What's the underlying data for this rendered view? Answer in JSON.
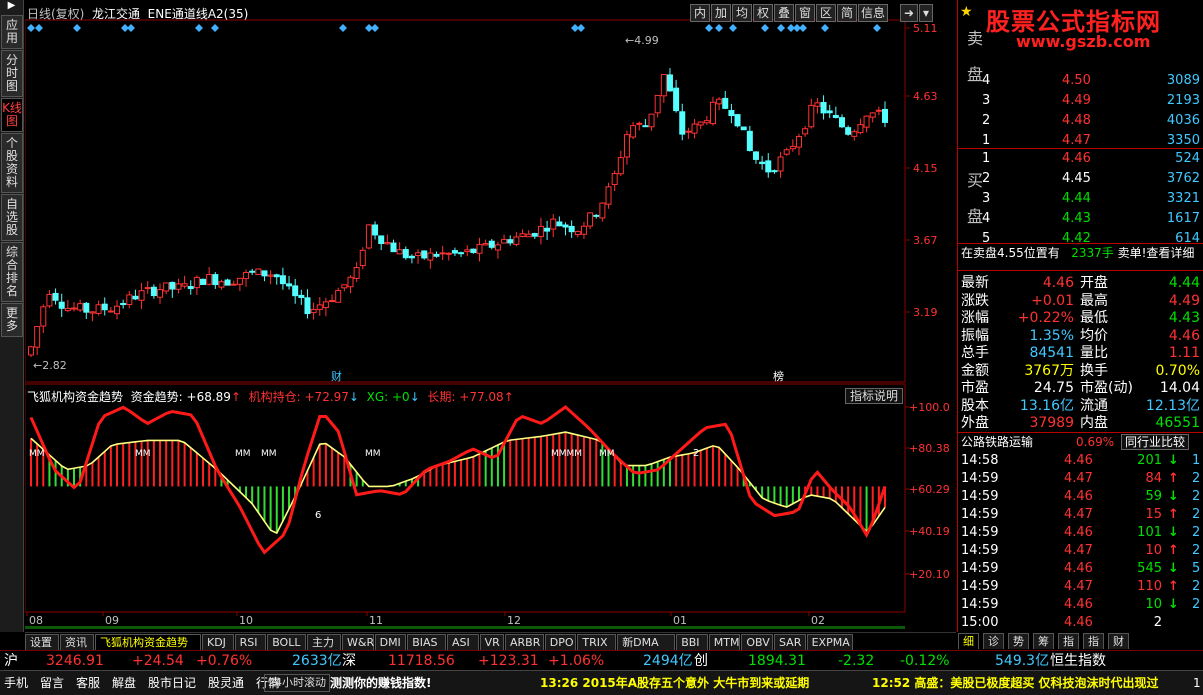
{
  "sidebar": [
    "应用",
    "分时图",
    "K线图",
    "个股资料",
    "自选股",
    "综合排名",
    "更多"
  ],
  "title": {
    "mode": "日线(复权)",
    "stock": "龙江交通",
    "indicator": "ENE通道线A2(35)"
  },
  "toolbar": [
    "内",
    "加",
    "均",
    "权",
    "叠",
    "窗",
    "区",
    "简",
    "信息"
  ],
  "price_axis": [
    "5.11",
    "4.63",
    "4.15",
    "3.67",
    "3.19"
  ],
  "price_marks": {
    "high": "4.99",
    "low": "2.82"
  },
  "markers": {
    "cai": "财",
    "bang": "榜"
  },
  "ind_header": {
    "name": "飞狐机构资金趋势",
    "t1": "资金趋势: +68.89",
    "t2": "机构持仓: +72.97",
    "t3": "XG: +0",
    "t4": "长期: +77.08",
    "btn": "指标说明"
  },
  "ind_axis": [
    "+100.0",
    "+80.38",
    "+60.29",
    "+40.19",
    "+20.10"
  ],
  "ind_labels": {
    "mm": "MM",
    "mmmm": "MMMM",
    "six": "6",
    "two": "2"
  },
  "months": [
    "08",
    "09",
    "10",
    "11",
    "12",
    "01",
    "02"
  ],
  "tabs": [
    "设置",
    "资讯",
    "飞狐机构资金趋势",
    "KDJ",
    "RSI",
    "BOLL",
    "主力",
    "W&R",
    "DMI",
    "BIAS",
    "ASI",
    "VR",
    "ARBR",
    "DPO",
    "TRIX",
    "新DMA",
    "BBI",
    "MTM",
    "OBV",
    "SAR",
    "EXPMA"
  ],
  "right": {
    "logo": "股票公式指标网",
    "url": "www.gszb.com",
    "sell_label": "卖盘",
    "buy_label": "买盘",
    "sell": [
      [
        "4",
        "4.50",
        "3089"
      ],
      [
        "3",
        "4.49",
        "2193"
      ],
      [
        "2",
        "4.48",
        "4036"
      ],
      [
        "1",
        "4.47",
        "3350"
      ]
    ],
    "buy": [
      [
        "1",
        "4.46",
        "524"
      ],
      [
        "2",
        "4.45",
        "3762"
      ],
      [
        "3",
        "4.44",
        "3321"
      ],
      [
        "4",
        "4.43",
        "1617"
      ],
      [
        "5",
        "4.42",
        "614"
      ]
    ],
    "notice": "在卖盘4.55位置有",
    "notice_vol": "2337手",
    "notice_tail": "卖单!查看详细",
    "stats": [
      [
        "最新",
        "4.46",
        "开盘",
        "4.44"
      ],
      [
        "涨跌",
        "+0.01",
        "最高",
        "4.49"
      ],
      [
        "涨幅",
        "+0.22%",
        "最低",
        "4.43"
      ],
      [
        "振幅",
        "1.35%",
        "均价",
        "4.46"
      ],
      [
        "总手",
        "84541",
        "量比",
        "1.11"
      ],
      [
        "金额",
        "3767万",
        "换手",
        "0.70%"
      ],
      [
        "市盈",
        "24.75",
        "市盈(动)",
        "14.04"
      ],
      [
        "股本",
        "13.16亿",
        "流通",
        "12.13亿"
      ],
      [
        "外盘",
        "37989",
        "内盘",
        "46551"
      ]
    ],
    "sector": "公路铁路运输",
    "sector_pct": "0.69%",
    "sector_btn": "同行业比较",
    "ticks": [
      [
        "14:58",
        "4.46",
        "201",
        "↓",
        "1"
      ],
      [
        "14:59",
        "4.47",
        "84",
        "↑",
        "2"
      ],
      [
        "14:59",
        "4.46",
        "59",
        "↓",
        "2"
      ],
      [
        "14:59",
        "4.47",
        "15",
        "↑",
        "2"
      ],
      [
        "14:59",
        "4.46",
        "101",
        "↓",
        "2"
      ],
      [
        "14:59",
        "4.47",
        "10",
        "↑",
        "2"
      ],
      [
        "14:59",
        "4.46",
        "545",
        "↓",
        "5"
      ],
      [
        "14:59",
        "4.47",
        "110",
        "↑",
        "2"
      ],
      [
        "14:59",
        "4.46",
        "10",
        "↓",
        "2"
      ],
      [
        "15:00",
        "4.46",
        "2",
        "",
        ""
      ]
    ],
    "rtabs": [
      "细",
      "诊",
      "势",
      "筹",
      "指",
      "指",
      "财"
    ]
  },
  "index_bar": {
    "sh": "沪",
    "sh_val": "3246.91",
    "sh_chg": "+24.54",
    "sh_pct": "+0.76%",
    "sh_amt": "2633亿",
    "sz": "深",
    "sz_val": "11718.56",
    "sz_chg": "+123.31",
    "sz_pct": "+1.06%",
    "sz_amt": "2494亿",
    "cy": "创",
    "cy_val": "1894.31",
    "cy_chg": "-2.32",
    "cy_pct": "-0.12%",
    "hk_amt": "549.3亿",
    "hk": "恒生指数"
  },
  "status": {
    "items": [
      "手机",
      "留言",
      "客服",
      "解盘",
      "股市日记",
      "股灵通",
      "行情"
    ],
    "scroll": "24小时滚动",
    "scroll_text": "测测你的赚钱指数!",
    "news1": "13:26 2015年A股存五个意外 大牛市到来或延期",
    "news2": "12:52 高盛：美股已极度超买 仅科技泡沫时代出现过",
    "tail": "1"
  }
}
